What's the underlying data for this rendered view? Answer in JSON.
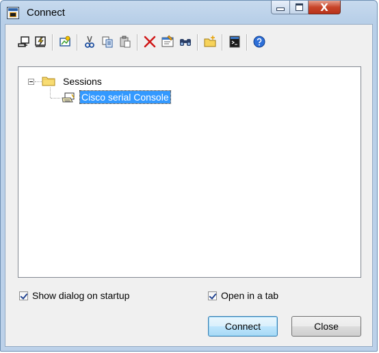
{
  "window": {
    "title": "Connect",
    "controls": {
      "minimize": "minimize",
      "maximize": "maximize",
      "close": "X"
    }
  },
  "toolbar": {
    "buttons": [
      {
        "name": "connect-icon"
      },
      {
        "name": "quick-connect-icon"
      },
      {
        "name": "connect-in-tab-icon"
      },
      {
        "name": "cut-icon"
      },
      {
        "name": "copy-icon"
      },
      {
        "name": "paste-icon"
      },
      {
        "name": "delete-icon"
      },
      {
        "name": "properties-icon"
      },
      {
        "name": "find-icon"
      },
      {
        "name": "new-folder-icon"
      },
      {
        "name": "desktop-shortcut-icon"
      },
      {
        "name": "help-icon"
      }
    ]
  },
  "tree": {
    "root_label": "Sessions",
    "children": [
      {
        "label": "Cisco serial Console",
        "selected": true
      }
    ]
  },
  "options": {
    "show_dialog_on_startup": {
      "label": "Show dialog on startup",
      "checked": true
    },
    "open_in_tab": {
      "label": "Open in a tab",
      "checked": true
    }
  },
  "buttons": {
    "connect": "Connect",
    "close": "Close"
  },
  "colors": {
    "selection": "#3399ff",
    "close_button": "#c8452a",
    "frame": "#bcd1e9"
  }
}
